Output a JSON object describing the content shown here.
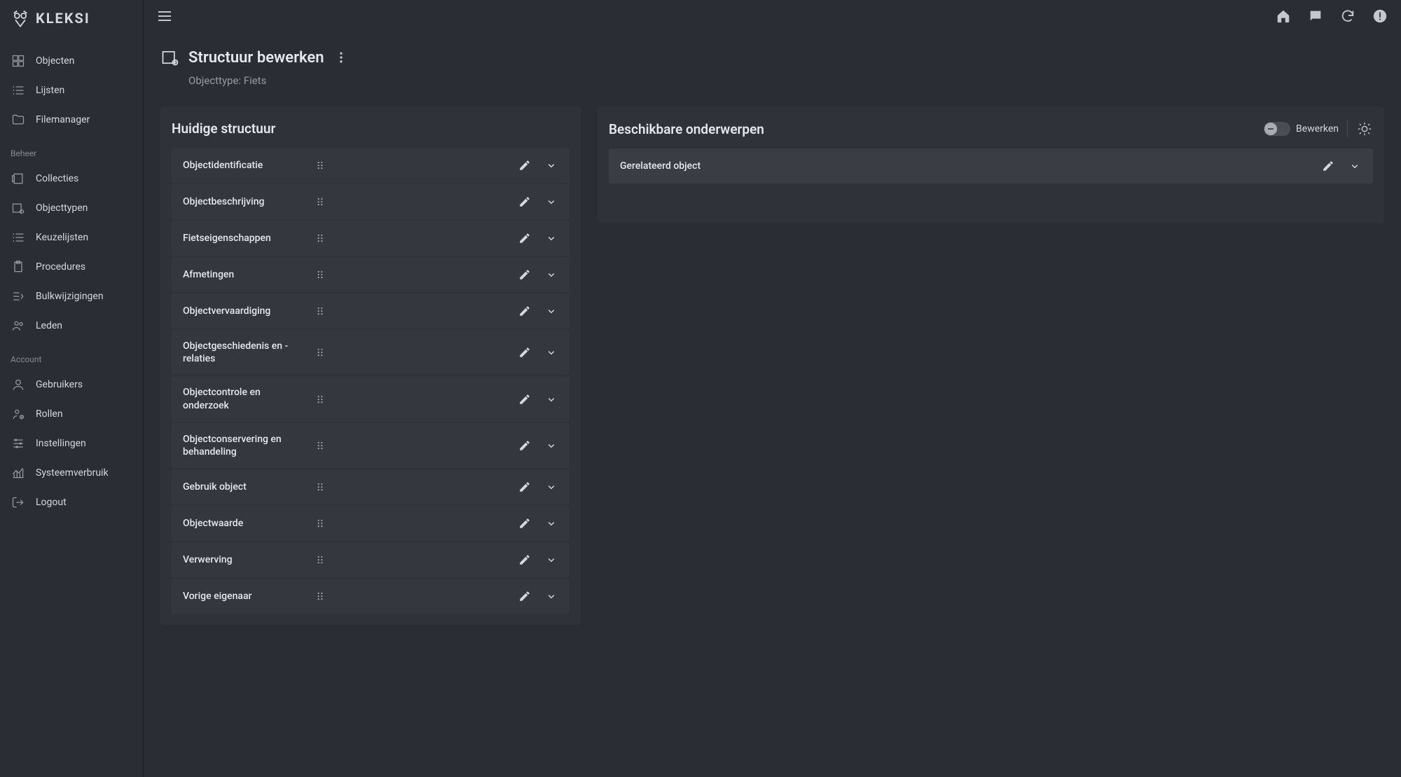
{
  "app": {
    "name": "KLEKSI"
  },
  "sidebar": {
    "main": [
      {
        "label": "Objecten",
        "icon": "grid"
      },
      {
        "label": "Lijsten",
        "icon": "list"
      },
      {
        "label": "Filemanager",
        "icon": "folder"
      }
    ],
    "beheer_heading": "Beheer",
    "beheer": [
      {
        "label": "Collecties",
        "icon": "collection"
      },
      {
        "label": "Objecttypen",
        "icon": "objecttype"
      },
      {
        "label": "Keuzelijsten",
        "icon": "list"
      },
      {
        "label": "Procedures",
        "icon": "clipboard"
      },
      {
        "label": "Bulkwijzigingen",
        "icon": "bulk"
      },
      {
        "label": "Leden",
        "icon": "members"
      }
    ],
    "account_heading": "Account",
    "account": [
      {
        "label": "Gebruikers",
        "icon": "user"
      },
      {
        "label": "Rollen",
        "icon": "roles"
      },
      {
        "label": "Instellingen",
        "icon": "sliders"
      },
      {
        "label": "Systeemverbruik",
        "icon": "chart"
      },
      {
        "label": "Logout",
        "icon": "logout"
      }
    ]
  },
  "header": {
    "title": "Structuur bewerken",
    "subtitle": "Objecttype: Fiets"
  },
  "panel_left": {
    "title": "Huidige structuur",
    "items": [
      {
        "label": "Objectidentificatie"
      },
      {
        "label": "Objectbeschrijving"
      },
      {
        "label": "Fietseigenschappen"
      },
      {
        "label": "Afmetingen"
      },
      {
        "label": "Objectvervaardiging"
      },
      {
        "label": "Objectgeschiedenis en -relaties"
      },
      {
        "label": "Objectcontrole en onderzoek"
      },
      {
        "label": "Objectconservering en behandeling"
      },
      {
        "label": "Gebruik object"
      },
      {
        "label": "Objectwaarde"
      },
      {
        "label": "Verwerving"
      },
      {
        "label": "Vorige eigenaar"
      }
    ]
  },
  "panel_right": {
    "title": "Beschikbare onderwerpen",
    "toggle_label": "Bewerken",
    "items": [
      {
        "label": "Gerelateerd object"
      }
    ]
  }
}
